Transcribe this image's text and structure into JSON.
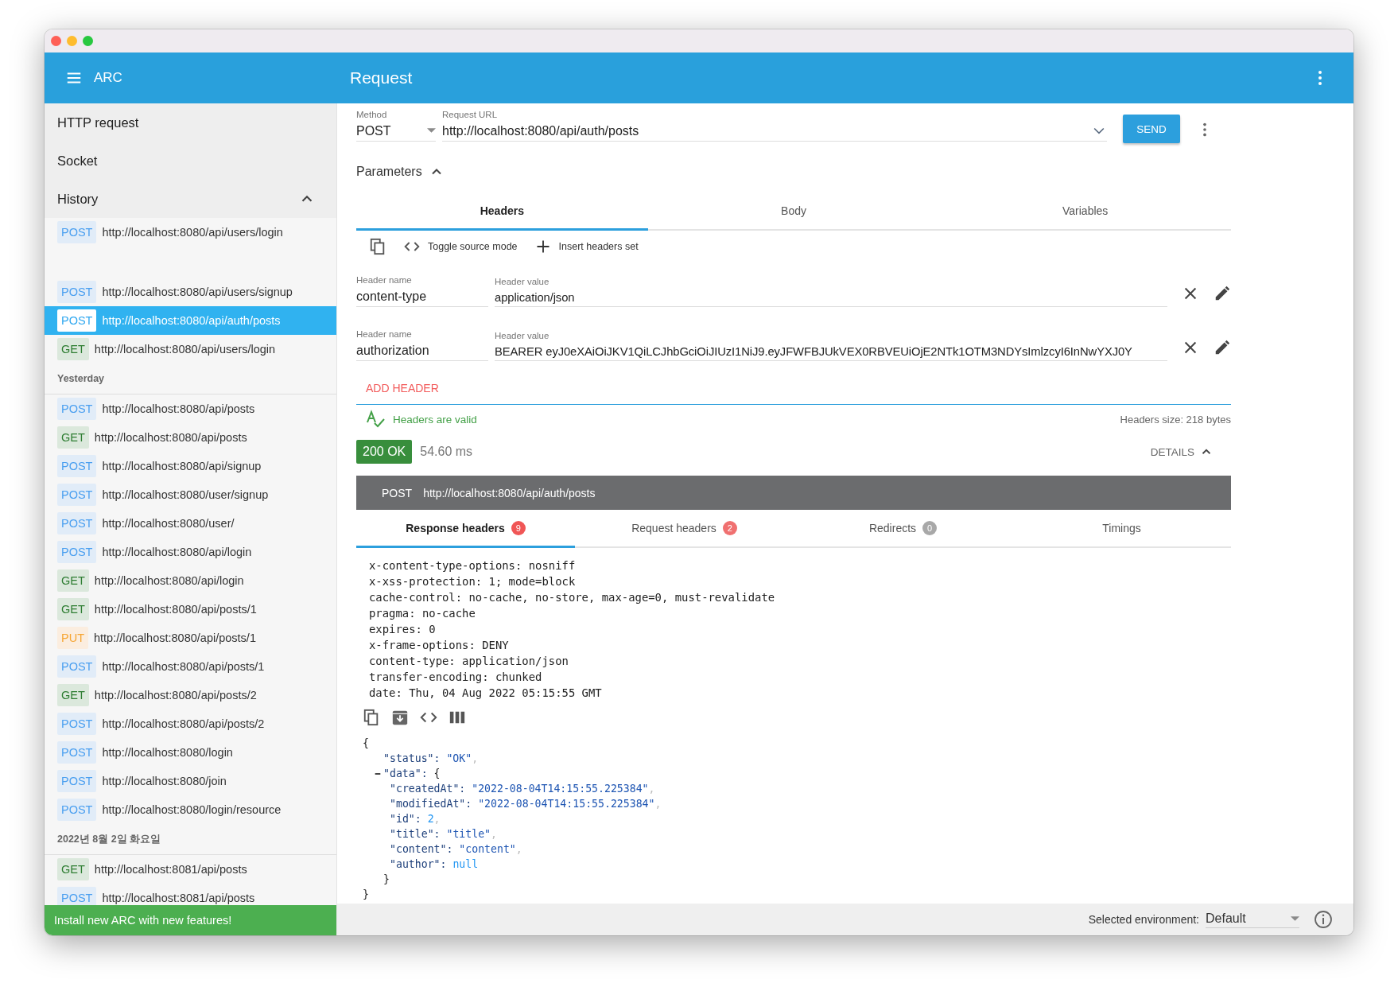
{
  "app_bar": {
    "menu": "ARC",
    "title": "Request"
  },
  "sidebar": {
    "nav": [
      {
        "label": "HTTP request"
      },
      {
        "label": "Socket"
      }
    ],
    "history": {
      "label": "History",
      "expanded": true,
      "groups": [
        {
          "items": [
            {
              "kind": "post",
              "method": "POST",
              "url": "http://localhost:8080/api/users/login",
              "selected": false
            },
            {
              "kind": "post",
              "method": "POST",
              "url": "http://localhost:8080/api/users/signup",
              "selected": false
            },
            {
              "kind": "post",
              "method": "POST",
              "url": "http://localhost:8080/api/auth/posts",
              "selected": true
            },
            {
              "kind": "get",
              "method": "GET",
              "url": "http://localhost:8080/api/users/login",
              "selected": false
            }
          ]
        },
        {
          "heading": "Yesterday",
          "items": [
            {
              "kind": "post",
              "method": "POST",
              "url": "http://localhost:8080/api/posts",
              "selected": false
            },
            {
              "kind": "get",
              "method": "GET",
              "url": "http://localhost:8080/api/posts",
              "selected": false
            },
            {
              "kind": "post",
              "method": "POST",
              "url": "http://localhost:8080/api/signup",
              "selected": false
            },
            {
              "kind": "post",
              "method": "POST",
              "url": "http://localhost:8080/user/signup",
              "selected": false
            },
            {
              "kind": "post",
              "method": "POST",
              "url": "http://localhost:8080/user/",
              "selected": false
            },
            {
              "kind": "post",
              "method": "POST",
              "url": "http://localhost:8080/api/login",
              "selected": false
            },
            {
              "kind": "get",
              "method": "GET",
              "url": "http://localhost:8080/api/login",
              "selected": false
            },
            {
              "kind": "get",
              "method": "GET",
              "url": "http://localhost:8080/api/posts/1",
              "selected": false
            },
            {
              "kind": "put",
              "method": "PUT",
              "url": "http://localhost:8080/api/posts/1",
              "selected": false
            },
            {
              "kind": "post",
              "method": "POST",
              "url": "http://localhost:8080/api/posts/1",
              "selected": false
            },
            {
              "kind": "get",
              "method": "GET",
              "url": "http://localhost:8080/api/posts/2",
              "selected": false
            },
            {
              "kind": "post",
              "method": "POST",
              "url": "http://localhost:8080/api/posts/2",
              "selected": false
            },
            {
              "kind": "post",
              "method": "POST",
              "url": "http://localhost:8080/login",
              "selected": false
            },
            {
              "kind": "post",
              "method": "POST",
              "url": "http://localhost:8080/join",
              "selected": false
            },
            {
              "kind": "post",
              "method": "POST",
              "url": "http://localhost:8080/login/resource",
              "selected": false
            }
          ]
        },
        {
          "heading": "2022년 8월 2일 화요일",
          "items": [
            {
              "kind": "get",
              "method": "GET",
              "url": "http://localhost:8081/api/posts",
              "selected": false
            },
            {
              "kind": "post",
              "method": "POST",
              "url": "http://localhost:8081/api/posts",
              "selected": false
            }
          ]
        }
      ]
    },
    "banner": "Install new ARC with new features!"
  },
  "request": {
    "method": {
      "label": "Method",
      "value": "POST"
    },
    "url": {
      "label": "Request URL",
      "value": "http://localhost:8080/api/auth/posts"
    },
    "send": "SEND",
    "parameters": {
      "label": "Parameters",
      "expanded": true
    },
    "tabs": [
      {
        "label": "Headers",
        "selected": true
      },
      {
        "label": "Body",
        "selected": false
      },
      {
        "label": "Variables",
        "selected": false
      }
    ],
    "toolbar": [
      {
        "kind": "copy"
      },
      {
        "kind": "code",
        "label": "Toggle source mode"
      },
      {
        "kind": "add",
        "label": "Insert headers set"
      }
    ],
    "headers": [
      {
        "name_label": "Header name",
        "name": "content-type",
        "value_label": "Header value",
        "value": "application/json"
      },
      {
        "name_label": "Header name",
        "name": "authorization",
        "value_label": "Header value",
        "value": "BEARER eyJ0eXAiOiJKV1QiLCJhbGciOiJIUzI1NiJ9.eyJFWFBJUkVEX0RBVEUiOjE2NTk1OTM3NDYsImlzcyI6InNwYXJ0Y"
      }
    ],
    "add_header": "ADD HEADER",
    "validation": "Headers are valid",
    "headers_size": "Headers size: 218 bytes"
  },
  "response": {
    "status": {
      "kind": "success",
      "label": "200 OK"
    },
    "time": "54.60 ms",
    "details": {
      "label": "DETAILS",
      "expanded": true
    },
    "request_line": {
      "method": "POST",
      "url": "http://localhost:8080/api/auth/posts"
    },
    "tabs": [
      {
        "label": "Response headers",
        "count": "9",
        "color": "#f05656",
        "selected": true
      },
      {
        "label": "Request headers",
        "count": "2",
        "color": "#f07070",
        "selected": false
      },
      {
        "label": "Redirects",
        "count": "0",
        "color": "#a8a8a8",
        "selected": false
      },
      {
        "label": "Timings",
        "selected": false
      }
    ],
    "headers": [
      "x-content-type-options: nosniff",
      "x-xss-protection: 1; mode=block",
      "cache-control: no-cache, no-store, max-age=0, must-revalidate",
      "pragma: no-cache",
      "expires: 0",
      "x-frame-options: DENY",
      "content-type: application/json",
      "transfer-encoding: chunked",
      "date: Thu, 04 Aug 2022 05:15:55 GMT"
    ],
    "body_toolbar": [
      {
        "kind": "copy"
      },
      {
        "kind": "save"
      },
      {
        "kind": "code"
      },
      {
        "kind": "columns"
      }
    ],
    "body": {
      "open": "{",
      "close": "}",
      "entries": [
        {
          "key": "\"status\":",
          "value": "\"OK\"",
          "kind": "string",
          "sep": ","
        },
        {
          "key": "\"data\":",
          "open": "{",
          "close": "}",
          "expanded": true,
          "entries": [
            {
              "key": "\"createdAt\":",
              "value": "\"2022-08-04T14:15:55.225384\"",
              "kind": "string",
              "sep": ","
            },
            {
              "key": "\"modifiedAt\":",
              "value": "\"2022-08-04T14:15:55.225384\"",
              "kind": "string",
              "sep": ","
            },
            {
              "key": "\"id\":",
              "value": "2",
              "kind": "number",
              "sep": ","
            },
            {
              "key": "\"title\":",
              "value": "\"title\"",
              "kind": "string",
              "sep": ","
            },
            {
              "key": "\"content\":",
              "value": "\"content\"",
              "kind": "string",
              "sep": ","
            },
            {
              "key": "\"author\":",
              "value": "null",
              "kind": "null"
            }
          ]
        }
      ]
    }
  },
  "status_bar": {
    "label": "Selected environment:",
    "value": "Default"
  }
}
